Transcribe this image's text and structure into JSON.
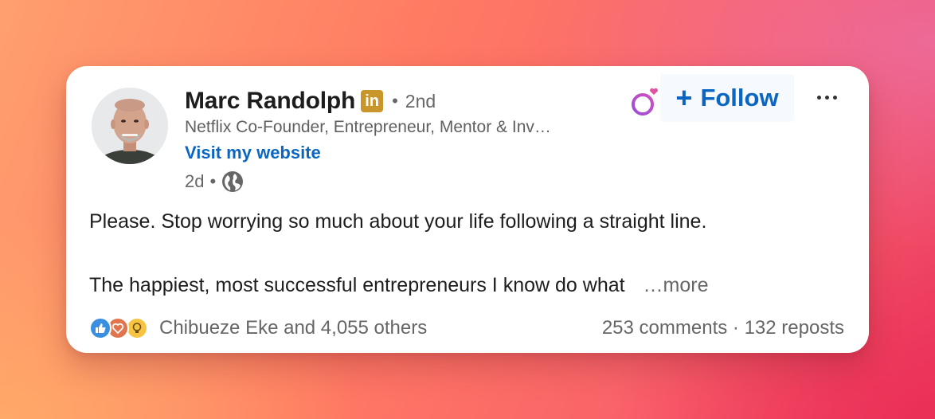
{
  "author": {
    "name": "Marc Randolph",
    "badge": "in",
    "connection_degree": "2nd",
    "headline": "Netflix Co-Founder, Entrepreneur, Mentor & Inv…",
    "website_link": "Visit my website",
    "posted_time": "2d",
    "visibility_icon": "globe-icon"
  },
  "actions": {
    "pronoun_icon": "gender-symbol-icon",
    "follow_label": "Follow",
    "follow_icon": "plus-icon",
    "more_icon": "ellipsis-icon"
  },
  "post": {
    "line1": "Please. Stop worrying so much about your life following a straight line.",
    "line2": "The happiest, most successful entrepreneurs I know do what",
    "see_more": "…more"
  },
  "social": {
    "reaction_icons": [
      "like-icon",
      "love-icon",
      "insightful-icon"
    ],
    "reactions_text": "Chibueze Eke and 4,055 others",
    "comments": "253 comments",
    "separator": "·",
    "reposts": "132 reposts"
  },
  "colors": {
    "link_blue": "#0a66c2",
    "linkedin_badge": "#c8962a",
    "card_bg": "#ffffff"
  }
}
